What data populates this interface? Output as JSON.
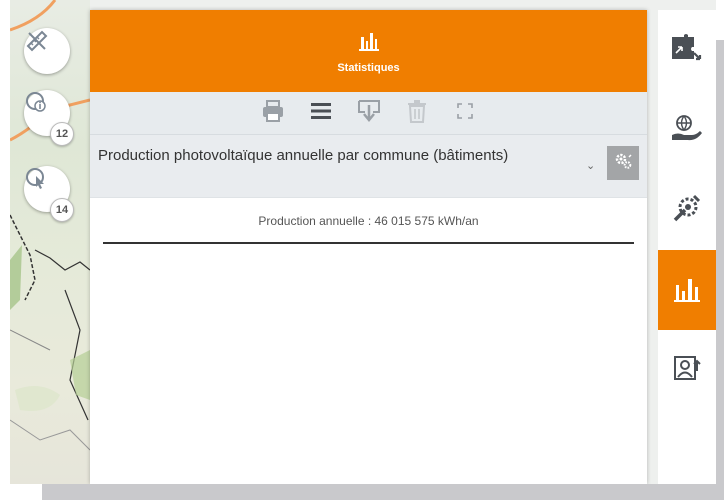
{
  "panel": {
    "title": "Statistiques",
    "header_icon": "bar-chart-icon",
    "toolbar": [
      {
        "name": "print-button",
        "icon": "printer-icon"
      },
      {
        "name": "list-button",
        "icon": "list-icon"
      },
      {
        "name": "download-button",
        "icon": "download-icon"
      },
      {
        "name": "delete-button",
        "icon": "trash-icon"
      },
      {
        "name": "fullscreen-button",
        "icon": "expand-icon"
      }
    ],
    "layer": {
      "label": "Production photovoltaïque annuelle par commune (bâtiments)",
      "chevron_icon": "chevron-down-icon",
      "settings_icon": "gears-icon"
    },
    "production_text": "Production annuelle : 46 015 575 kWh/an"
  },
  "map_tools": [
    {
      "icon": "measure-tool-icon"
    },
    {
      "icon": "info-select-icon",
      "count": "12"
    },
    {
      "icon": "cursor-select-icon",
      "count": "14"
    }
  ],
  "sidebar": [
    {
      "icon": "puzzle-icon",
      "active": false
    },
    {
      "icon": "globe-hand-icon",
      "active": false
    },
    {
      "icon": "wrench-gear-icon",
      "active": false
    },
    {
      "icon": "bar-chart-icon",
      "active": true
    },
    {
      "icon": "contact-export-icon",
      "active": false
    }
  ],
  "colors": {
    "accent": "#f07e00",
    "toolbar_bg": "#e7ebee",
    "icon_gray": "#9aa0a6",
    "settings_bg": "#a3a5a7"
  }
}
